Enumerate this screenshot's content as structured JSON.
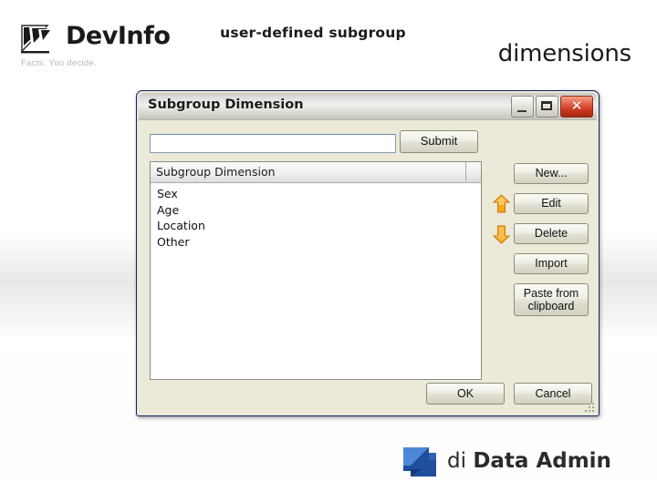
{
  "slide": {
    "logo": {
      "name": "DevInfo",
      "tagline": "Facts. You decide.",
      "icon": "devinfo-logo-icon"
    },
    "heading": {
      "line1": "user-defined subgroup",
      "line2": "dimensions"
    },
    "footer": {
      "prefix": "di ",
      "product": "Data Admin",
      "icon": "data-admin-logo-icon"
    }
  },
  "dialog": {
    "title": "Subgroup Dimension",
    "window_buttons": {
      "minimize": "minimize-icon",
      "maximize": "maximize-icon",
      "close": "close-icon"
    },
    "input": {
      "value": "",
      "placeholder": ""
    },
    "submit_label": "Submit",
    "list": {
      "column_header": "Subgroup Dimension",
      "rows": [
        "Sex",
        "Age",
        "Location",
        "Other"
      ]
    },
    "reorder": {
      "up": "arrow-up-icon",
      "down": "arrow-down-icon"
    },
    "side_buttons": [
      {
        "label": "New...",
        "name": "new-button"
      },
      {
        "label": "Edit",
        "name": "edit-button"
      },
      {
        "label": "Delete",
        "name": "delete-button"
      },
      {
        "label": "Import",
        "name": "import-button"
      },
      {
        "label": "Paste from clipboard",
        "name": "paste-from-clipboard-button"
      }
    ],
    "ok_label": "OK",
    "cancel_label": "Cancel"
  },
  "colors": {
    "dialog_face": "#ece9d8",
    "title_text": "#1b1b1b",
    "close_red": "#c8341b",
    "arrow_orange": "#f5a71a",
    "logo_blue": "#1f4e9c"
  }
}
